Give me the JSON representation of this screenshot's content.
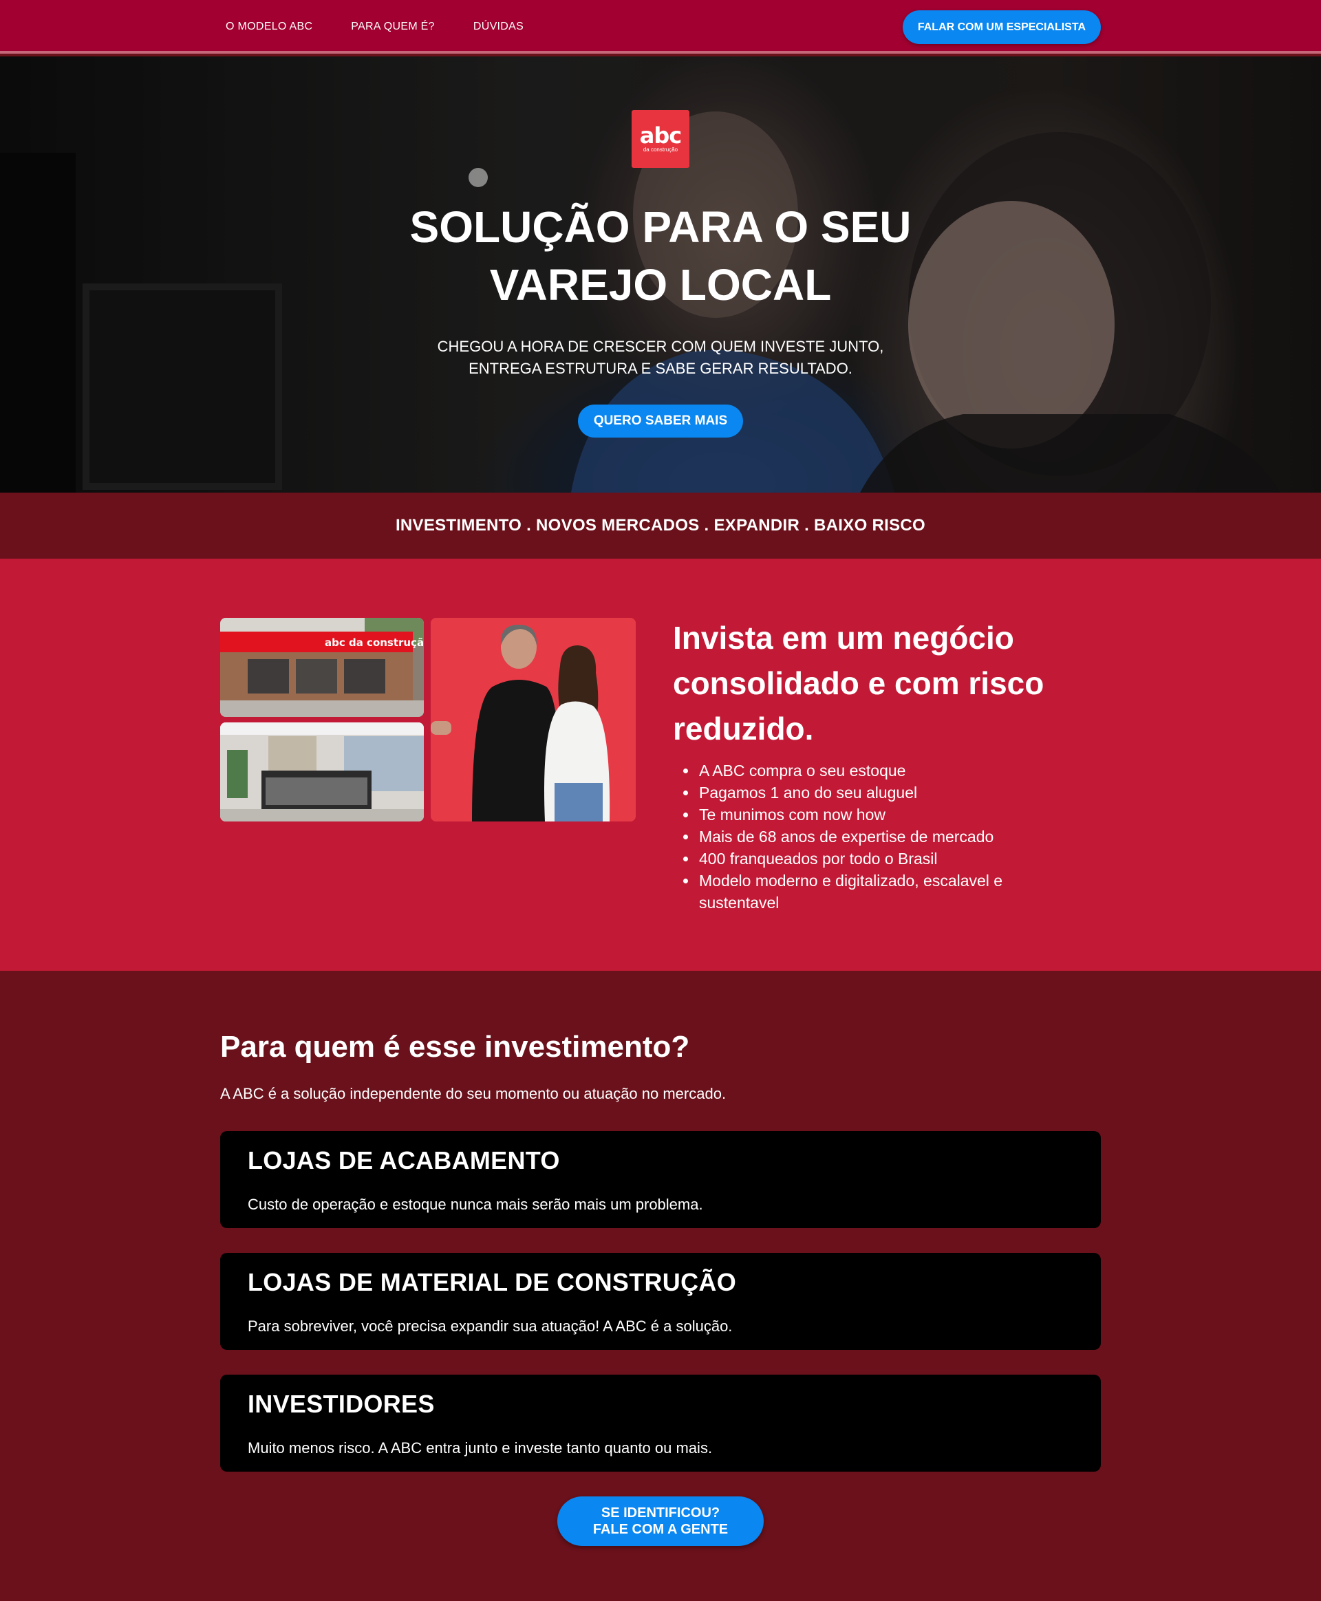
{
  "nav": {
    "links": [
      "O MODELO ABC",
      "PARA QUEM É?",
      "DÚVIDAS"
    ],
    "cta": "FALAR COM UM ESPECIALISTA"
  },
  "hero": {
    "logo_main": "abc",
    "logo_sub": "da construção",
    "title": "SOLUÇÃO PARA O SEU VAREJO LOCAL",
    "subtitle_line1": "CHEGOU A HORA DE CRESCER COM QUEM INVESTE JUNTO,",
    "subtitle_line2": "ENTREGA ESTRUTURA E SABE GERAR RESULTADO.",
    "cta": "QUERO SABER MAIS"
  },
  "strip": {
    "text": "INVESTIMENTO . NOVOS MERCADOS . EXPANDIR . BAIXO RISCO"
  },
  "feature": {
    "store_sign": "abc da construção",
    "title": "Invista em um negócio consolidado e com risco reduzido.",
    "items": [
      "A ABC compra o seu estoque",
      "Pagamos 1 ano do seu aluguel",
      "Te munimos com now how",
      "Mais de 68 anos de expertise de mercado",
      "400 franqueados por todo o Brasil",
      "Modelo moderno e digitalizado, escalavel e sustentavel"
    ]
  },
  "forwhom": {
    "title": "Para quem é esse investimento?",
    "subtitle": "A ABC é a solução independente do seu momento ou atuação no mercado.",
    "cards": [
      {
        "title": "LOJAS DE ACABAMENTO",
        "text": "Custo de operação e estoque nunca mais serão mais um problema."
      },
      {
        "title": "LOJAS DE MATERIAL DE CONSTRUÇÃO",
        "text": "Para sobreviver, você precisa expandir sua atuação! A ABC é a solução."
      },
      {
        "title": "INVESTIDORES",
        "text": "Muito menos risco. A ABC entra junto e investe tanto quanto ou mais."
      }
    ],
    "cta_line1": "SE IDENTIFICOU?",
    "cta_line2": "FALE COM A GENTE"
  },
  "colors": {
    "nav_bg": "#a10030",
    "accent_blue": "#0a87f0",
    "feature_bg": "#c21a36",
    "dark_red": "#6a111b",
    "logo_red": "#e8343e",
    "card_bg": "#000000"
  }
}
